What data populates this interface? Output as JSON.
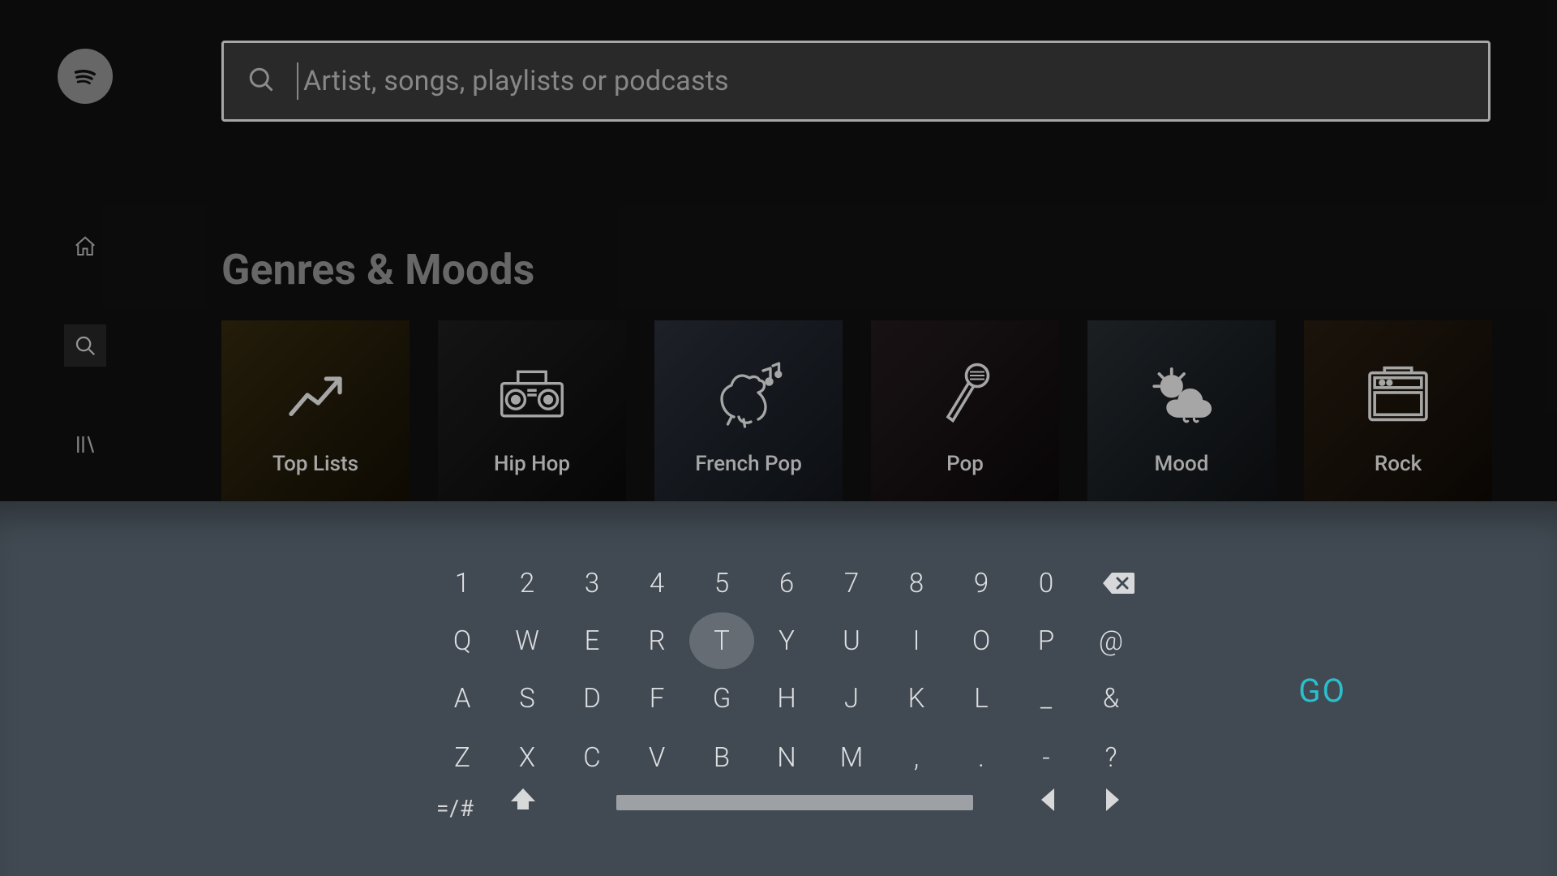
{
  "search": {
    "placeholder": "Artist, songs, playlists or podcasts",
    "value": ""
  },
  "sidebar": {
    "items": [
      {
        "name": "home"
      },
      {
        "name": "search",
        "active": true
      },
      {
        "name": "library"
      }
    ]
  },
  "section": {
    "title": "Genres & Moods",
    "tiles": [
      {
        "label": "Top Lists",
        "icon": "trend-up-icon",
        "bg": "bg-toplists"
      },
      {
        "label": "Hip Hop",
        "icon": "boombox-icon",
        "bg": "bg-hiphop"
      },
      {
        "label": "French Pop",
        "icon": "rooster-music-icon",
        "bg": "bg-frenchpop"
      },
      {
        "label": "Pop",
        "icon": "microphone-icon",
        "bg": "bg-pop"
      },
      {
        "label": "Mood",
        "icon": "sun-cloud-icon",
        "bg": "bg-mood"
      },
      {
        "label": "Rock",
        "icon": "amplifier-icon",
        "bg": "bg-rock"
      }
    ]
  },
  "keyboard": {
    "row1": [
      "1",
      "2",
      "3",
      "4",
      "5",
      "6",
      "7",
      "8",
      "9",
      "0"
    ],
    "row2": [
      "Q",
      "W",
      "E",
      "R",
      "T",
      "Y",
      "U",
      "I",
      "O",
      "P",
      "@"
    ],
    "row3": [
      "A",
      "S",
      "D",
      "F",
      "G",
      "H",
      "J",
      "K",
      "L",
      "_",
      "&"
    ],
    "row4": [
      "Z",
      "X",
      "C",
      "V",
      "B",
      "N",
      "M",
      ",",
      ".",
      "-",
      "?"
    ],
    "focused": "T",
    "symbols_label": "=/#",
    "go_label": "GO"
  }
}
